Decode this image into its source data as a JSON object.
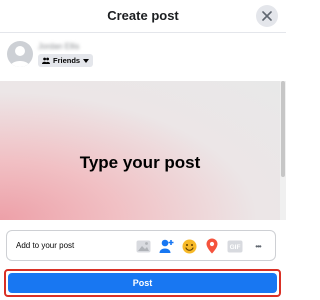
{
  "header": {
    "title": "Create post"
  },
  "user": {
    "name": "Jordan Ellis",
    "privacy_label": "Friends"
  },
  "composer": {
    "prompt": "Type your post"
  },
  "add_bar": {
    "label": "Add to your post",
    "icons": [
      "photo-video-icon",
      "tag-people-icon",
      "feeling-icon",
      "check-in-icon",
      "gif-icon",
      "more-icon"
    ],
    "gif_label": "GIF",
    "more_label": "•••"
  },
  "post_button": {
    "label": "Post"
  },
  "colors": {
    "accent": "#1877f2",
    "highlight": "#d93025",
    "feeling": "#f7b928",
    "checkin": "#f5533d",
    "tag": "#1877f2"
  }
}
